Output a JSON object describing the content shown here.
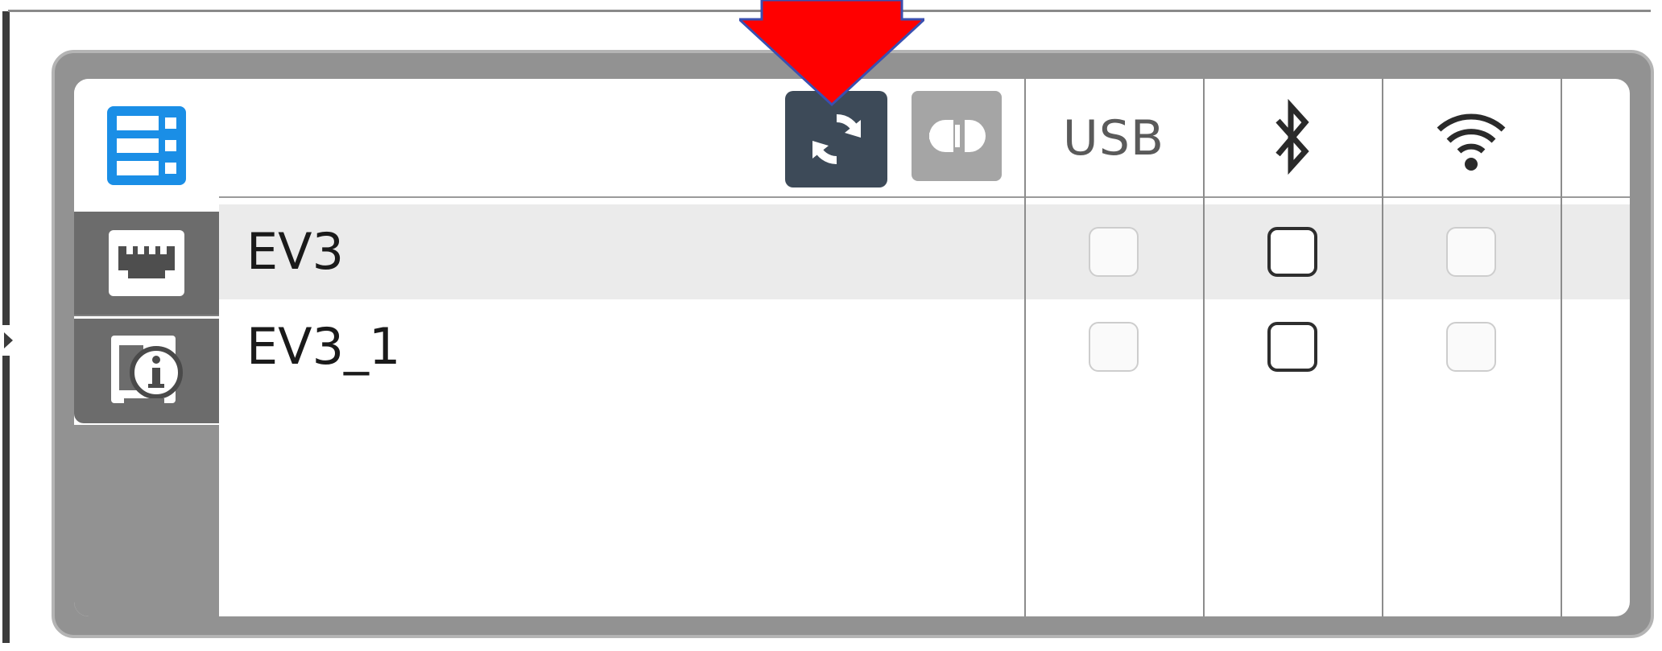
{
  "window": {
    "connections_header": {
      "usb_label": "USB"
    },
    "bricks": [
      {
        "name": "EV3",
        "selected": true,
        "usb": false,
        "bluetooth": false,
        "wifi": false
      },
      {
        "name": "EV3_1",
        "selected": false,
        "usb": false,
        "bluetooth": false,
        "wifi": false
      }
    ],
    "tabs": [
      "brick-list-icon",
      "ports-icon",
      "brick-info-icon"
    ],
    "icons": {
      "refresh": "refresh-icon",
      "connect": "connect-icon",
      "bluetooth": "bluetooth-icon",
      "wifi": "wifi-icon",
      "annotation": "red-arrow-icon"
    },
    "colors": {
      "accent_blue": "#1a8ee6",
      "refresh_button": "#3d4a58",
      "panel_grey": "#929292",
      "tab_dark": "#6c6c6c",
      "annotation_red": "#ff0000"
    }
  }
}
